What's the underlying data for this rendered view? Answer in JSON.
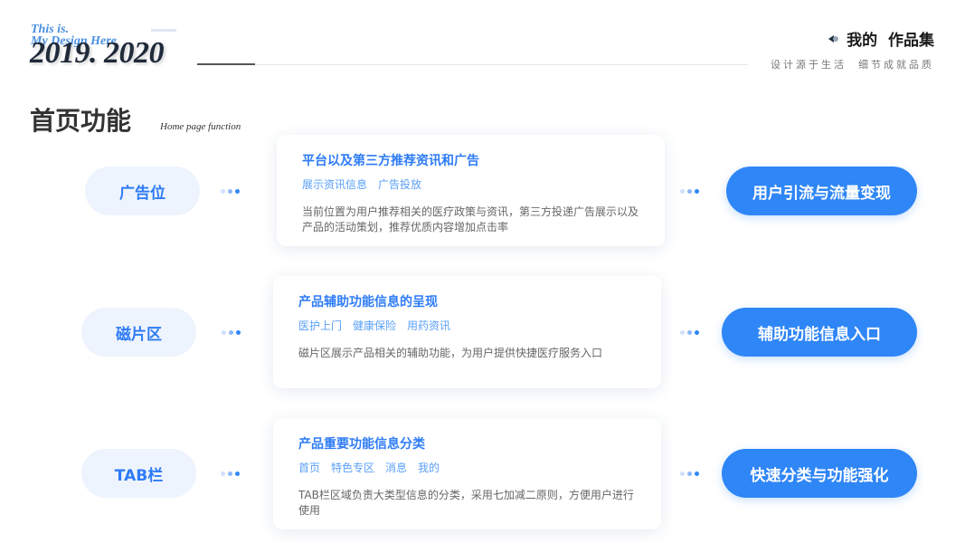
{
  "header": {
    "tagline_1": "This is.",
    "tagline_2": "My Design Here",
    "year": "2019. 2020",
    "brand_name": "我的  作品集",
    "brand_slogan": "设计源于生活  细节成就品质"
  },
  "section": {
    "title": "首页功能",
    "subtitle": "Home page function"
  },
  "colors": {
    "accent": "#2f86f6",
    "pill_bg": "#eef4fd",
    "dot_light": "#cfe0fb",
    "dot_mid": "#8cb8f7",
    "dot_dark": "#2f86f6"
  },
  "rows": [
    {
      "label": "广告位",
      "card_title": "平台以及第三方推荐资讯和广告",
      "tags": [
        "展示资讯信息",
        "广告投放"
      ],
      "description": "当前位置为用户推荐相关的医疗政策与资讯，第三方投递广告展示以及产品的活动策划，推荐优质内容增加点击率",
      "result": "用户引流与流量变现"
    },
    {
      "label": "磁片区",
      "card_title": "产品辅助功能信息的呈现",
      "tags": [
        "医护上门",
        "健康保险",
        "用药资讯"
      ],
      "description": "磁片区展示产品相关的辅助功能，为用户提供快捷医疗服务入口",
      "result": "辅助功能信息入口"
    },
    {
      "label": "TAB栏",
      "card_title": "产品重要功能信息分类",
      "tags": [
        "首页",
        "特色专区",
        "消息",
        "我的"
      ],
      "description": "TAB栏区域负责大类型信息的分类，采用七加减二原则，方便用户进行使用",
      "result": "快速分类与功能强化"
    }
  ]
}
